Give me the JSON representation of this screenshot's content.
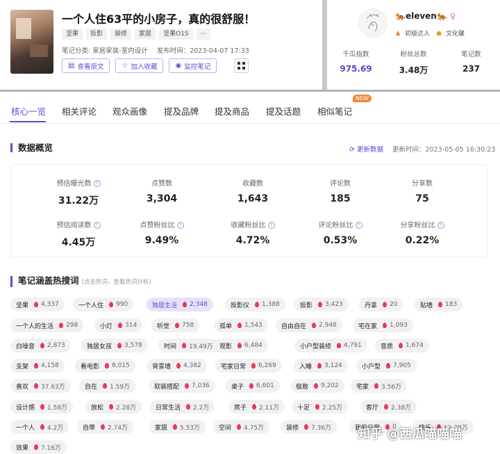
{
  "note": {
    "title": "一个人住63平的小房子，真的很舒服！",
    "tags": [
      "坚果",
      "投影",
      "装修",
      "家居",
      "坚果O1S",
      "···"
    ],
    "category": "笔记分类: 家居家装-室内设计",
    "publish_time": "发布时间：2023-04-07 17:33",
    "buttons": {
      "view": "查看原文",
      "fav": "加入收藏",
      "monitor": "监控笔记"
    }
  },
  "user": {
    "name": "eleven",
    "level": "初级达人",
    "tag": "文化馨",
    "stats": [
      {
        "label": "千瓜指数",
        "value": "975.69"
      },
      {
        "label": "粉丝总数",
        "value": "3.48万"
      },
      {
        "label": "笔记数",
        "value": "237"
      }
    ]
  },
  "tabs": [
    "核心一览",
    "相关评论",
    "观众画像",
    "提及品牌",
    "提及商品",
    "提及话题",
    "相似笔记"
  ],
  "new_badge": "NEW",
  "overview": {
    "title": "数据概览",
    "refresh": "更新数据",
    "update_time": "更新时间：2023-05-05 16:30:23",
    "row1": [
      {
        "label": "预估曝光数",
        "value": "31.22万",
        "q": true
      },
      {
        "label": "点赞数",
        "value": "3,304",
        "q": false
      },
      {
        "label": "收藏数",
        "value": "1,643",
        "q": false
      },
      {
        "label": "评论数",
        "value": "185",
        "q": false
      },
      {
        "label": "分享数",
        "value": "75",
        "q": false
      }
    ],
    "row2": [
      {
        "label": "预估阅读数",
        "value": "4.45万",
        "q": true
      },
      {
        "label": "点赞粉丝比",
        "value": "9.49%",
        "q": true
      },
      {
        "label": "收藏粉丝比",
        "value": "4.72%",
        "q": true
      },
      {
        "label": "评论粉丝比",
        "value": "0.53%",
        "q": true
      },
      {
        "label": "分享粉丝比",
        "value": "0.22%",
        "q": true
      }
    ]
  },
  "keywords_section": {
    "title": "笔记涵盖热搜词",
    "hint": "(点击热词，查看热词分析)"
  },
  "keywords": [
    [
      [
        "坚果",
        "4,337"
      ],
      [
        "一个人住",
        "990"
      ],
      [
        "独居生活",
        "2,348"
      ],
      [
        "投影仪",
        "1,388"
      ],
      [
        "投影",
        "3,423"
      ],
      [
        "丹拿",
        "20"
      ],
      [
        "贴墙",
        "183"
      ]
    ],
    [
      [
        "一个人的生活",
        "298"
      ],
      [
        "小灯",
        "314"
      ],
      [
        "听觉",
        "758"
      ],
      [
        "孤单",
        "1,543"
      ],
      [
        "自由自在",
        "2,948"
      ],
      [
        "宅在家",
        "1,093"
      ]
    ],
    [
      [
        "白噪音",
        "2,873"
      ],
      [
        "独居女孩",
        "3,578"
      ],
      [
        "时间",
        "19.49万"
      ],
      [
        "观影",
        "6,484"
      ],
      [
        "小户型装修",
        "4,791"
      ],
      [
        "音质",
        "1,674"
      ]
    ],
    [
      [
        "支架",
        "4,158"
      ],
      [
        "看电影",
        "8,015"
      ],
      [
        "背景墙",
        "4,382"
      ],
      [
        "宅家日常",
        "6,269"
      ],
      [
        "入睡",
        "3,124"
      ],
      [
        "小户型",
        "7,905"
      ]
    ],
    [
      [
        "喜欢",
        "37.63万"
      ],
      [
        "自在",
        "1.59万"
      ],
      [
        "软装搭配",
        "7,036"
      ],
      [
        "桌子",
        "6,601"
      ],
      [
        "极致",
        "9,202"
      ],
      [
        "宅家",
        "3.56万"
      ]
    ],
    [
      [
        "设计感",
        "1.58万"
      ],
      [
        "放松",
        "2.28万"
      ],
      [
        "日常生活",
        "2.2万"
      ],
      [
        "房子",
        "2.11万"
      ],
      [
        "十足",
        "2.25万"
      ],
      [
        "客厅",
        "2.38万"
      ]
    ],
    [
      [
        "一个人",
        "4.2万"
      ],
      [
        "自带",
        "2.74万"
      ],
      [
        "家居",
        "5.53万"
      ],
      [
        "空间",
        "4.75万"
      ],
      [
        "装修",
        "7.36万"
      ],
      [
        "我的日常",
        "0"
      ],
      [
        "快乐",
        "12.28万"
      ]
    ],
    [
      [
        "效果",
        "7.16万"
      ]
    ]
  ],
  "watermark": "知乎 @西瓜喵喵喵"
}
